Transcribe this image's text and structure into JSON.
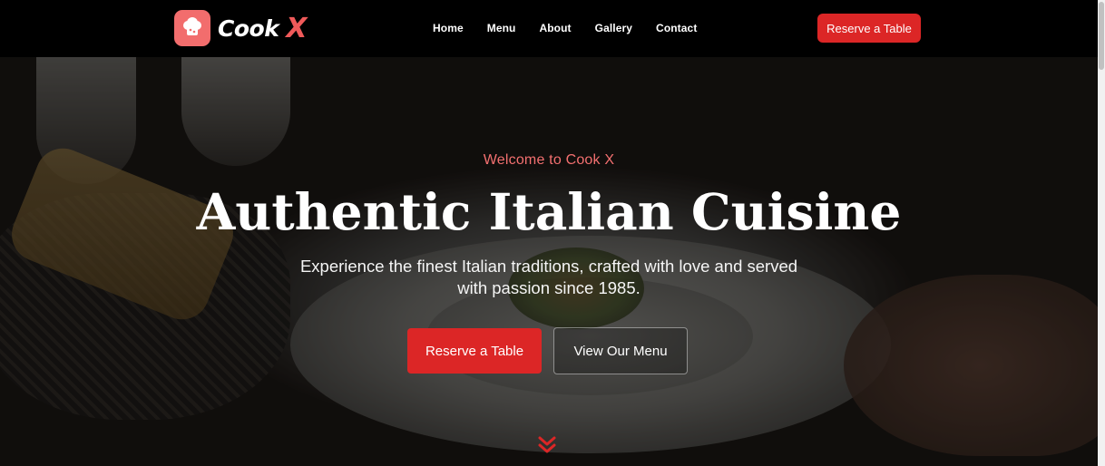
{
  "brand": {
    "name": "Cook",
    "accent": "X"
  },
  "nav": {
    "links": [
      "Home",
      "Menu",
      "About",
      "Gallery",
      "Contact"
    ],
    "cta_label": "Reserve a Table"
  },
  "hero": {
    "tagline": "Welcome to Cook X",
    "title": "Authentic Italian Cuisine",
    "subtitle_line1": "Experience the finest Italian traditions, crafted with love and served",
    "subtitle_line2": "with passion since 1985.",
    "primary_button": "Reserve a Table",
    "secondary_button": "View Our Menu",
    "scroll_icon": "double-chevron-down-icon"
  },
  "colors": {
    "accent": "#dc2626",
    "logo_bg": "#f26d6d",
    "tagline": "#f37070",
    "navbar_bg": "#000000"
  }
}
